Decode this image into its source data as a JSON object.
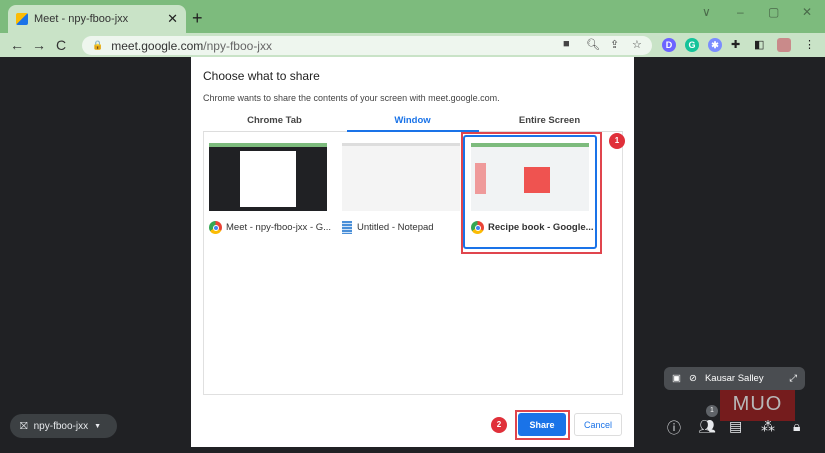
{
  "browser": {
    "tab_title": "Meet - npy-fboo-jxx",
    "url_host": "meet.google.com",
    "url_path": "/npy-fboo-jxx",
    "ext_d": "D",
    "ext_g": "G"
  },
  "dialog": {
    "title": "Choose what to share",
    "subtitle": "Chrome wants to share the contents of your screen with meet.google.com.",
    "tabs": [
      "Chrome Tab",
      "Window",
      "Entire Screen"
    ],
    "selected_tab": "Window",
    "windows": [
      {
        "label": "Meet - npy-fboo-jxx - G..."
      },
      {
        "label": "Untitled - Notepad"
      },
      {
        "label": "Recipe book - Google..."
      }
    ],
    "share": "Share",
    "cancel": "Cancel"
  },
  "annotations": [
    "1",
    "2"
  ],
  "meet": {
    "meeting_code": "npy-fboo-jxx",
    "participant_name": "Kausar Salley",
    "participant_count": "1",
    "watermark": "MUO"
  },
  "colors": {
    "accent": "#1a73e8",
    "chrome_green": "#7dbb7d",
    "annotation_red": "#e0303a"
  }
}
